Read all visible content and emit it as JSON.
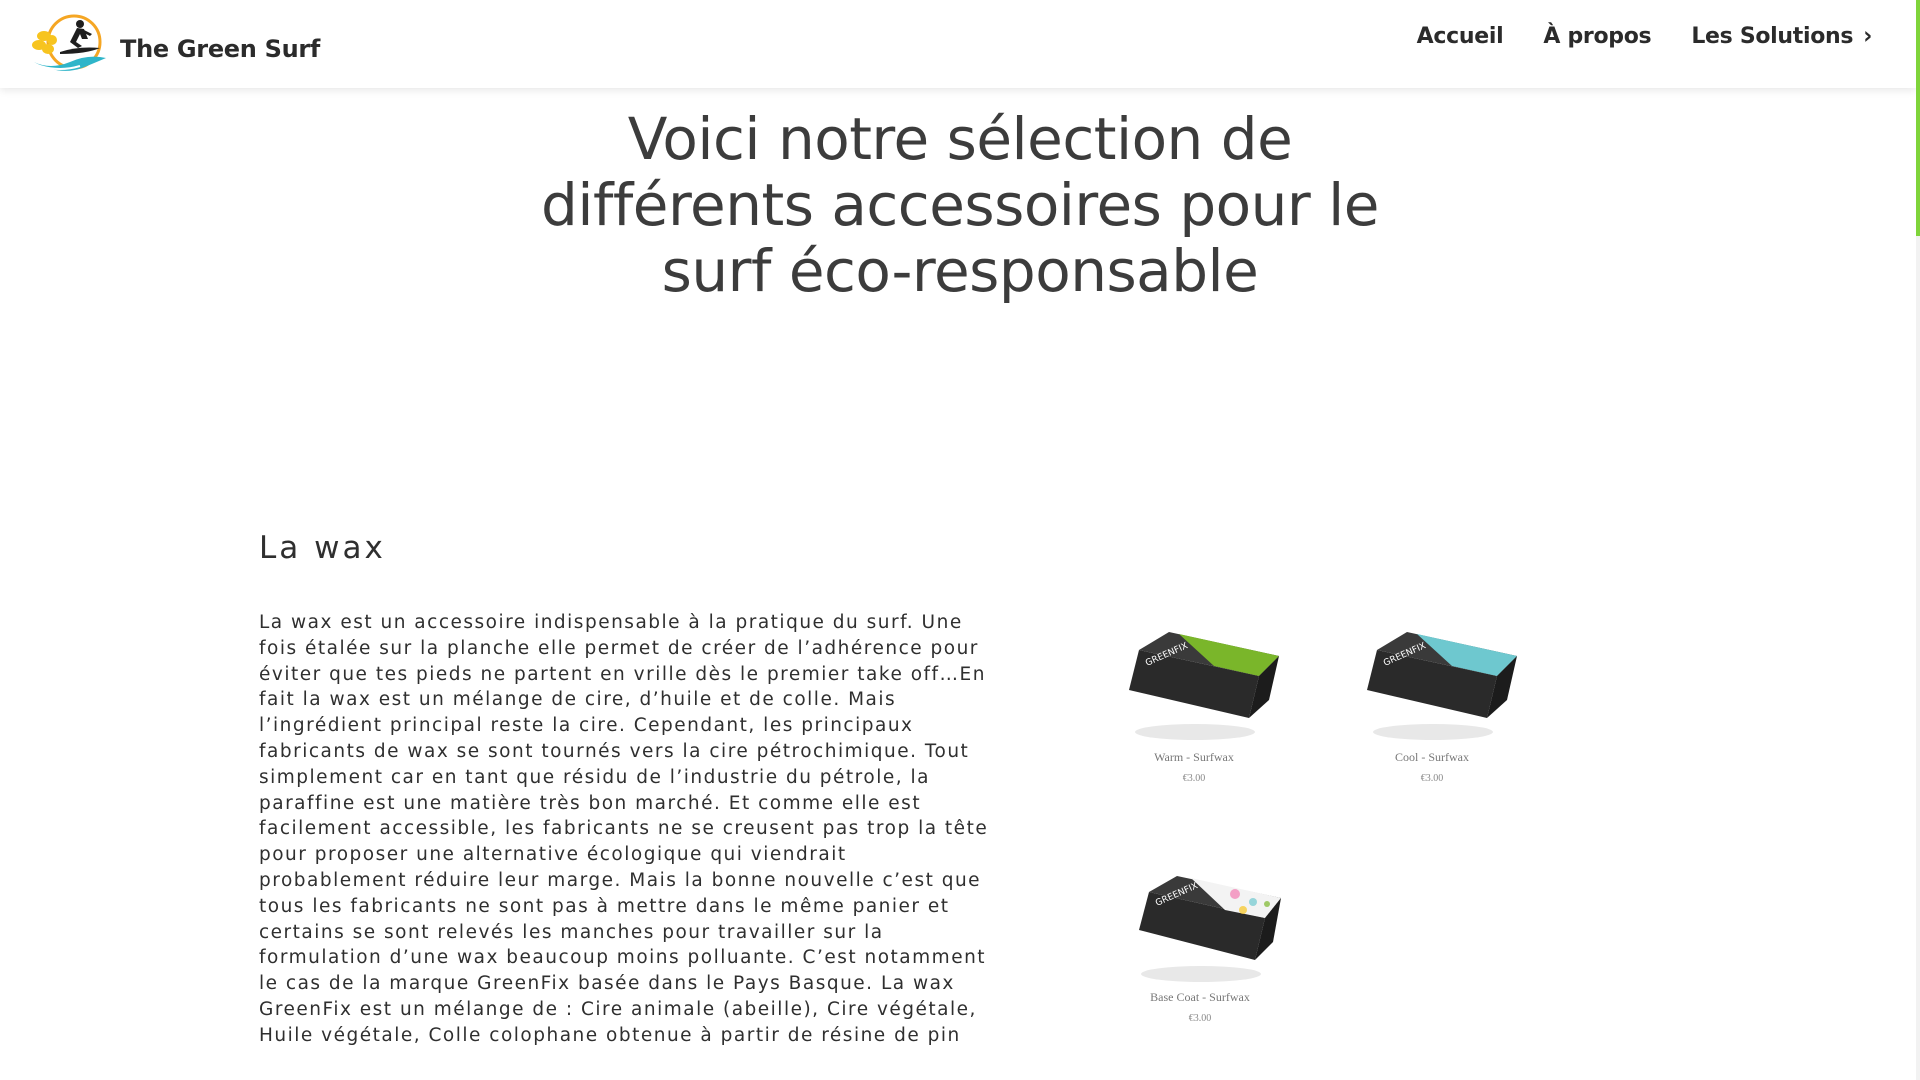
{
  "header": {
    "site_title": "The Green Surf",
    "nav": [
      {
        "label": "Accueil"
      },
      {
        "label": "À propos"
      },
      {
        "label": "Les Solutions",
        "has_submenu": true,
        "chevron": "›"
      }
    ]
  },
  "hero": {
    "title_lines": [
      "Voici notre sélection de",
      "différents accessoires pour le",
      "surf éco-responsable"
    ]
  },
  "wax_section": {
    "heading": "La wax",
    "paragraph_lines": [
      "La wax est un accessoire indispensable à la pratique du surf. Une",
      "fois étalée sur la planche elle permet de créer de l’adhérence pour",
      "éviter que tes pieds ne partent en vrille dès le premier take off…En",
      "fait la wax est un mélange de cire, d’huile et de colle. Mais",
      "l’ingrédient principal reste la cire. Cependant, les principaux",
      "fabricants de wax se sont tournés vers la cire pétrochimique. Tout",
      "simplement car en tant que résidu de l’industrie du pétrole, la",
      "paraffine est une matière très bon marché. Et comme elle est",
      "facilement accessible, les fabricants ne se creusent pas trop la tête",
      "pour proposer une alternative écologique qui viendrait",
      "probablement réduire leur marge. Mais la bonne nouvelle c’est que",
      "tous les fabricants ne sont pas à mettre dans le même panier et",
      "certains se sont relevés les manches pour travailler sur la",
      "formulation d’une wax beaucoup moins polluante. C’est notamment",
      "le cas de la marque GreenFix basée dans le Pays Basque. La wax",
      "GreenFix est un mélange de : Cire animale (abeille), Cire végétale,",
      "Huile végétale, Colle colophane obtenue à partir de résine de pin"
    ],
    "products": [
      {
        "name": "Warm - Surfwax",
        "price": "€3.00",
        "brand_on_box": "GREENFIX",
        "accent": "#7ab62a"
      },
      {
        "name": "Cool - Surfwax",
        "price": "€3.00",
        "brand_on_box": "GREENFIX",
        "accent": "#6ec8cf"
      },
      {
        "name": "Base Coat - Surfwax",
        "price": "€3.00",
        "brand_on_box": "GREENFIX",
        "accent": "multicolor"
      }
    ]
  },
  "colors": {
    "scroll_accent": "#7fd43a",
    "text": "#3a3a3a"
  },
  "icons": {
    "logo": "surfer-logo-icon",
    "chevron": "chevron-right-icon"
  }
}
